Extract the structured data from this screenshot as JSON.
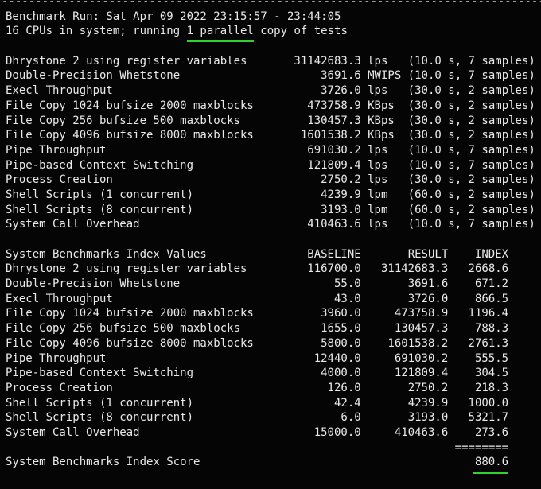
{
  "terminal": {
    "bg_color": "#050505",
    "text_color": "#e9e9e9",
    "accent_green": "#2fd32f",
    "top_divider": "------------------------------------------------------------------------------------------",
    "run_line": "Benchmark Run: Sat Apr 09 2022 23:15:57 - 23:44:05",
    "cpu_line": {
      "prefix": "16 CPUs in system; running ",
      "highlight": "1 parallel",
      "suffix": " copy of tests"
    }
  },
  "results": {
    "rows": [
      {
        "name": "Dhrystone 2 using register variables",
        "value": "31142683.3",
        "unit": "lps",
        "timing": "(10.0 s, 7 samples)"
      },
      {
        "name": "Double-Precision Whetstone",
        "value": "3691.6",
        "unit": "MWIPS",
        "timing": "(10.0 s, 7 samples)"
      },
      {
        "name": "Execl Throughput",
        "value": "3726.0",
        "unit": "lps",
        "timing": "(30.0 s, 2 samples)"
      },
      {
        "name": "File Copy 1024 bufsize 2000 maxblocks",
        "value": "473758.9",
        "unit": "KBps",
        "timing": "(30.0 s, 2 samples)"
      },
      {
        "name": "File Copy 256 bufsize 500 maxblocks",
        "value": "130457.3",
        "unit": "KBps",
        "timing": "(30.0 s, 2 samples)"
      },
      {
        "name": "File Copy 4096 bufsize 8000 maxblocks",
        "value": "1601538.2",
        "unit": "KBps",
        "timing": "(30.0 s, 2 samples)"
      },
      {
        "name": "Pipe Throughput",
        "value": "691030.2",
        "unit": "lps",
        "timing": "(10.0 s, 7 samples)"
      },
      {
        "name": "Pipe-based Context Switching",
        "value": "121809.4",
        "unit": "lps",
        "timing": "(10.0 s, 7 samples)"
      },
      {
        "name": "Process Creation",
        "value": "2750.2",
        "unit": "lps",
        "timing": "(30.0 s, 2 samples)"
      },
      {
        "name": "Shell Scripts (1 concurrent)",
        "value": "4239.9",
        "unit": "lpm",
        "timing": "(60.0 s, 2 samples)"
      },
      {
        "name": "Shell Scripts (8 concurrent)",
        "value": "3193.0",
        "unit": "lpm",
        "timing": "(60.0 s, 2 samples)"
      },
      {
        "name": "System Call Overhead",
        "value": "410463.6",
        "unit": "lps",
        "timing": "(10.0 s, 7 samples)"
      }
    ]
  },
  "index_table": {
    "title": "System Benchmarks Index Values",
    "columns": [
      "BASELINE",
      "RESULT",
      "INDEX"
    ],
    "rows": [
      {
        "name": "Dhrystone 2 using register variables",
        "baseline": "116700.0",
        "result": "31142683.3",
        "index": "2668.6"
      },
      {
        "name": "Double-Precision Whetstone",
        "baseline": "55.0",
        "result": "3691.6",
        "index": "671.2"
      },
      {
        "name": "Execl Throughput",
        "baseline": "43.0",
        "result": "3726.0",
        "index": "866.5"
      },
      {
        "name": "File Copy 1024 bufsize 2000 maxblocks",
        "baseline": "3960.0",
        "result": "473758.9",
        "index": "1196.4"
      },
      {
        "name": "File Copy 256 bufsize 500 maxblocks",
        "baseline": "1655.0",
        "result": "130457.3",
        "index": "788.3"
      },
      {
        "name": "File Copy 4096 bufsize 8000 maxblocks",
        "baseline": "5800.0",
        "result": "1601538.2",
        "index": "2761.3"
      },
      {
        "name": "Pipe Throughput",
        "baseline": "12440.0",
        "result": "691030.2",
        "index": "555.5"
      },
      {
        "name": "Pipe-based Context Switching",
        "baseline": "4000.0",
        "result": "121809.4",
        "index": "304.5"
      },
      {
        "name": "Process Creation",
        "baseline": "126.0",
        "result": "2750.2",
        "index": "218.3"
      },
      {
        "name": "Shell Scripts (1 concurrent)",
        "baseline": "42.4",
        "result": "4239.9",
        "index": "1000.0"
      },
      {
        "name": "Shell Scripts (8 concurrent)",
        "baseline": "6.0",
        "result": "3193.0",
        "index": "5321.7"
      },
      {
        "name": "System Call Overhead",
        "baseline": "15000.0",
        "result": "410463.6",
        "index": "273.6"
      }
    ],
    "score_divider": "========",
    "score_label": "System Benchmarks Index Score",
    "score": "880.6"
  }
}
